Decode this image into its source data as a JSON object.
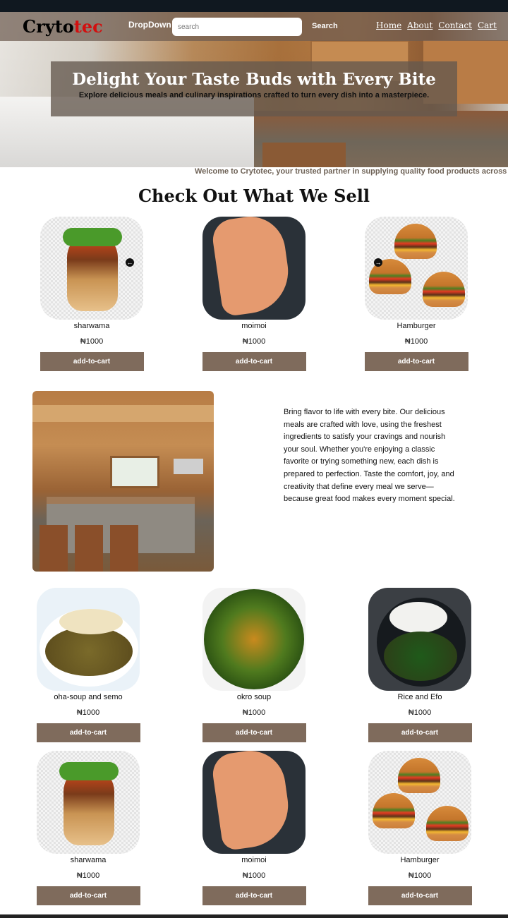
{
  "colors": {
    "accent": "#7f6b5c",
    "logo_tec": "#d20f0f",
    "topbar": "#101820"
  },
  "navbar": {
    "logo_main": "Cryto",
    "logo_accent": "tec",
    "dropdown_label": "DropDown",
    "search_placeholder": "search",
    "search_button": "Search",
    "links": [
      "Home",
      "About",
      "Contact",
      "Cart"
    ]
  },
  "hero": {
    "title": "Delight Your Taste Buds with Every Bite",
    "subtitle": "Explore delicious meals and culinary inspirations crafted to turn every dish into a masterpiece."
  },
  "marquee": "Welcome to Crytotec, your trusted partner in supplying quality food products across",
  "section_title": "Check Out What We Sell",
  "products_row1": [
    {
      "name": "sharwama",
      "price": "₦1000",
      "button": "add-to-cart"
    },
    {
      "name": "moimoi",
      "price": "₦1000",
      "button": "add-to-cart"
    },
    {
      "name": "Hamburger",
      "price": "₦1000",
      "button": "add-to-cart"
    }
  ],
  "carousel": {
    "prev_icon": "arrow-left-icon",
    "next_icon": "arrow-right-icon"
  },
  "about": {
    "text": "Bring flavor to life with every bite. Our delicious meals are crafted with love, using the freshest ingredients to satisfy your cravings and nourish your soul. Whether you're enjoying a classic favorite or trying something new, each dish is prepared to perfection. Taste the comfort, joy, and creativity that define every meal we serve—because great food makes every moment special."
  },
  "products_row2": [
    {
      "name": "oha-soup and semo",
      "price": "₦1000",
      "button": "add-to-cart"
    },
    {
      "name": "okro soup",
      "price": "₦1000",
      "button": "add-to-cart"
    },
    {
      "name": "Rice and Efo",
      "price": "₦1000",
      "button": "add-to-cart"
    }
  ],
  "products_row3": [
    {
      "name": "sharwama",
      "price": "₦1000",
      "button": "add-to-cart"
    },
    {
      "name": "moimoi",
      "price": "₦1000",
      "button": "add-to-cart"
    },
    {
      "name": "Hamburger",
      "price": "₦1000",
      "button": "add-to-cart"
    }
  ]
}
